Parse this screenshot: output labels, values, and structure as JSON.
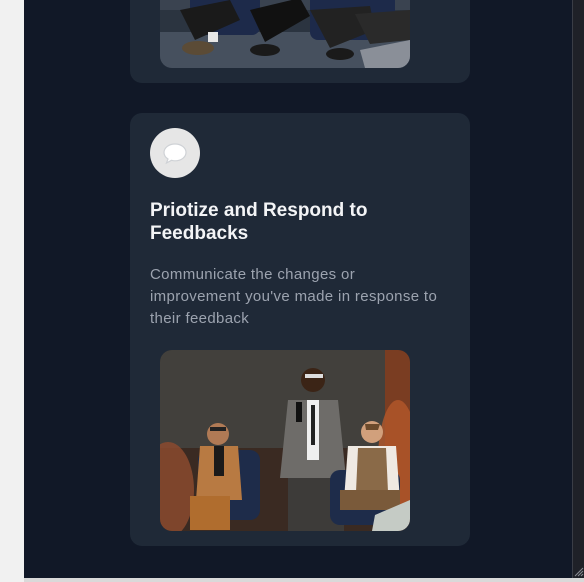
{
  "feature_card": {
    "icon": "speech-bubble-icon",
    "title": "Priotize and Respond to Feedbacks",
    "description": "Communicate the changes or improvement you've made in response to their feedback"
  },
  "colors": {
    "page_background": "#111827",
    "card_background": "#1f2937",
    "icon_badge": "#e6e6e6",
    "title": "#f3f4f6",
    "description": "#9ca3af"
  }
}
